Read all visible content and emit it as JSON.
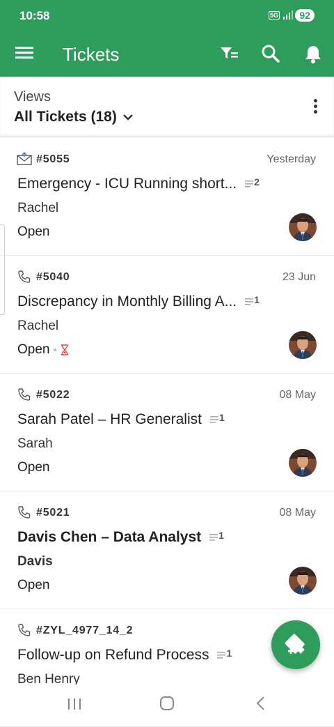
{
  "status_bar": {
    "time": "10:58",
    "network": "5G",
    "battery": "92"
  },
  "app_bar": {
    "title": "Tickets",
    "icons": [
      "menu-icon",
      "filter-icon",
      "search-icon",
      "bell-icon"
    ]
  },
  "views": {
    "label": "Views",
    "selected": "All Tickets (18)"
  },
  "tickets": [
    {
      "channel": "email-icon",
      "number": "#5055",
      "date": "Yesterday",
      "subject": "Emergency - ICU Running short...",
      "threads": "2",
      "contact": "Rachel",
      "status": "Open",
      "overdue": false,
      "unread": false
    },
    {
      "channel": "phone-icon",
      "number": "#5040",
      "date": "23 Jun",
      "subject": "Discrepancy in Monthly Billing A...",
      "threads": "1",
      "contact": "Rachel",
      "status": "Open",
      "overdue": true,
      "unread": false
    },
    {
      "channel": "phone-icon",
      "number": "#5022",
      "date": "08 May",
      "subject": "Sarah Patel – HR Generalist",
      "threads": "1",
      "contact": "Sarah",
      "status": "Open",
      "overdue": false,
      "unread": false
    },
    {
      "channel": "phone-icon",
      "number": "#5021",
      "date": "08 May",
      "subject": "Davis Chen – Data Analyst",
      "threads": "1",
      "contact": "Davis",
      "status": "Open",
      "overdue": false,
      "unread": true
    },
    {
      "channel": "phone-icon",
      "number": "#ZYL_4977_14_2",
      "date": "",
      "subject": "Follow-up on Refund Process",
      "threads": "1",
      "contact": "Ben Henry",
      "status": "",
      "overdue": false,
      "unread": false
    }
  ],
  "colors": {
    "brand": "#2e9d5c",
    "overdue": "#e04848"
  }
}
